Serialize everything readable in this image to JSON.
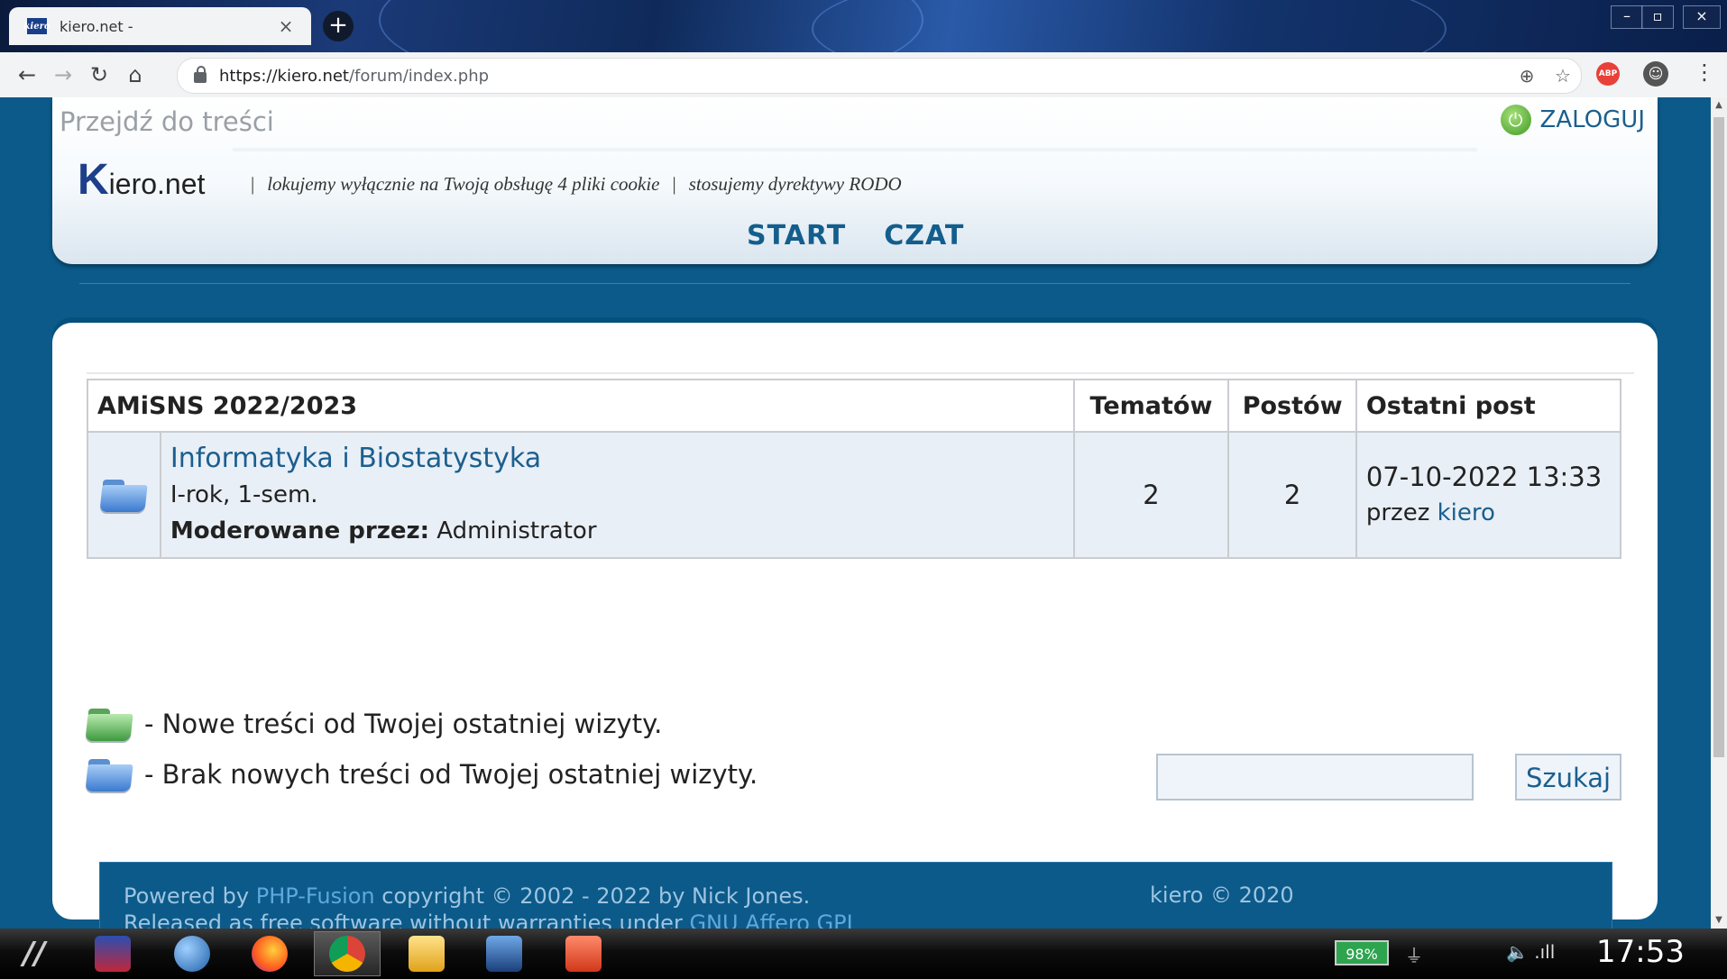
{
  "browser": {
    "tab_title": "kiero.net -",
    "favicon_text": "kiero",
    "url_host": "https://kiero.net",
    "url_path": "/forum/index.php",
    "abp_label": "ABP"
  },
  "header": {
    "skip_link": "Przejdź do treści",
    "login": "ZALOGUJ",
    "logo_k": "K",
    "logo_rest": "iero.net",
    "slogan_1": "lokujemy wyłącznie na Twoją obsługę 4 pliki cookie",
    "slogan_2": "stosujemy dyrektywy RODO",
    "nav": [
      "START",
      "CZAT"
    ]
  },
  "forum": {
    "category": "AMiSNS 2022/2023",
    "col_topics": "Tematów",
    "col_posts": "Postów",
    "col_last": "Ostatni post",
    "rows": [
      {
        "name": "Informatyka i Biostatystyka",
        "desc": "I-rok, 1-sem.",
        "moderated_label": "Moderowane przez:",
        "moderator": "Administrator",
        "topics": "2",
        "posts": "2",
        "last_date": "07-10-2022 13:33",
        "last_by_label": "przez",
        "last_by": "kiero"
      }
    ]
  },
  "legend": {
    "new": "- Nowe treści od Twojej ostatniej wizyty.",
    "none": "- Brak nowych treści od Twojej ostatniej wizyty."
  },
  "search": {
    "button": "Szukaj",
    "value": ""
  },
  "footer": {
    "powered_by": "Powered by",
    "php_fusion": "PHP-Fusion",
    "copyright": "copyright © 2002 - 2022 by Nick Jones.",
    "released": "Released as free software without warranties under",
    "license": "GNU Affero GPL",
    "right": "kiero © 2020"
  },
  "taskbar": {
    "battery": "98%",
    "clock": "17:53"
  },
  "colors": {
    "page_bg": "#0b5a8a",
    "link": "#1b5f8f",
    "nav": "#135e8c",
    "row_bg": "#e9eff6"
  }
}
